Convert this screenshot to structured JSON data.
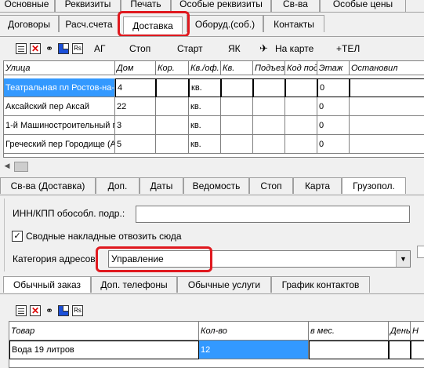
{
  "tabs_row1": [
    "Основные",
    "Реквизиты",
    "Печать",
    "Особые реквизиты",
    "Св-ва",
    "Особые цены"
  ],
  "tabs_row2": [
    "Договоры",
    "Расч.счета",
    "Доставка",
    "Оборуд.(соб.)",
    "Контакты"
  ],
  "toolbar1": {
    "icons": [
      "document-icon",
      "delete-icon",
      "binoculars-icon",
      "add-icon",
      "filter-icon"
    ],
    "buttons": [
      "АГ",
      "Стоп",
      "Старт",
      "ЯК",
      "На карте",
      "+ТЕЛ"
    ]
  },
  "address_grid": {
    "columns": [
      "Улица",
      "Дом",
      "Кор.",
      "Кв./оф.",
      "Кв.",
      "Подъезд",
      "Код под",
      "Этаж",
      "Остановил"
    ],
    "rows": [
      [
        "Театральная пл Ростов-на-",
        "4",
        "",
        "кв.",
        "",
        "",
        "",
        "0",
        ""
      ],
      [
        "Аксайский пер Аксай",
        "22",
        "",
        "кв.",
        "",
        "",
        "",
        "0",
        ""
      ],
      [
        "1-й Машиностроительный п",
        "3",
        "",
        "кв.",
        "",
        "",
        "",
        "0",
        ""
      ],
      [
        "Греческий пер Городище (А",
        "5",
        "",
        "кв.",
        "",
        "",
        "",
        "0",
        ""
      ]
    ]
  },
  "tabs_row3": [
    "Св-ва (Доставка)",
    "Доп.",
    "Даты",
    "Ведомость",
    "Стоп",
    "Карта",
    "Грузопол."
  ],
  "form": {
    "inn_label": "ИНН/КПП обособл. подр.:",
    "inn_value": "",
    "checkbox_label": "Сводные накладные отвозить сюда",
    "checkbox_checked": "✓",
    "category_label": "Категория адресов:",
    "category_value": "Управление"
  },
  "tabs_row4": [
    "Обычный заказ",
    "Доп. телефоны",
    "Обычные услуги",
    "График контактов"
  ],
  "toolbar2": {
    "icons": [
      "document-icon",
      "delete-icon",
      "binoculars-icon",
      "add-icon",
      "filter-icon"
    ]
  },
  "order_grid": {
    "columns": [
      "Товар",
      "Кол-во",
      "в мес.",
      "День",
      "Н"
    ],
    "rows": [
      [
        "Вода 19 литров",
        "12",
        "",
        "",
        ""
      ]
    ]
  },
  "colors": {
    "highlight": "#e0191f",
    "selection": "#3399ff"
  }
}
